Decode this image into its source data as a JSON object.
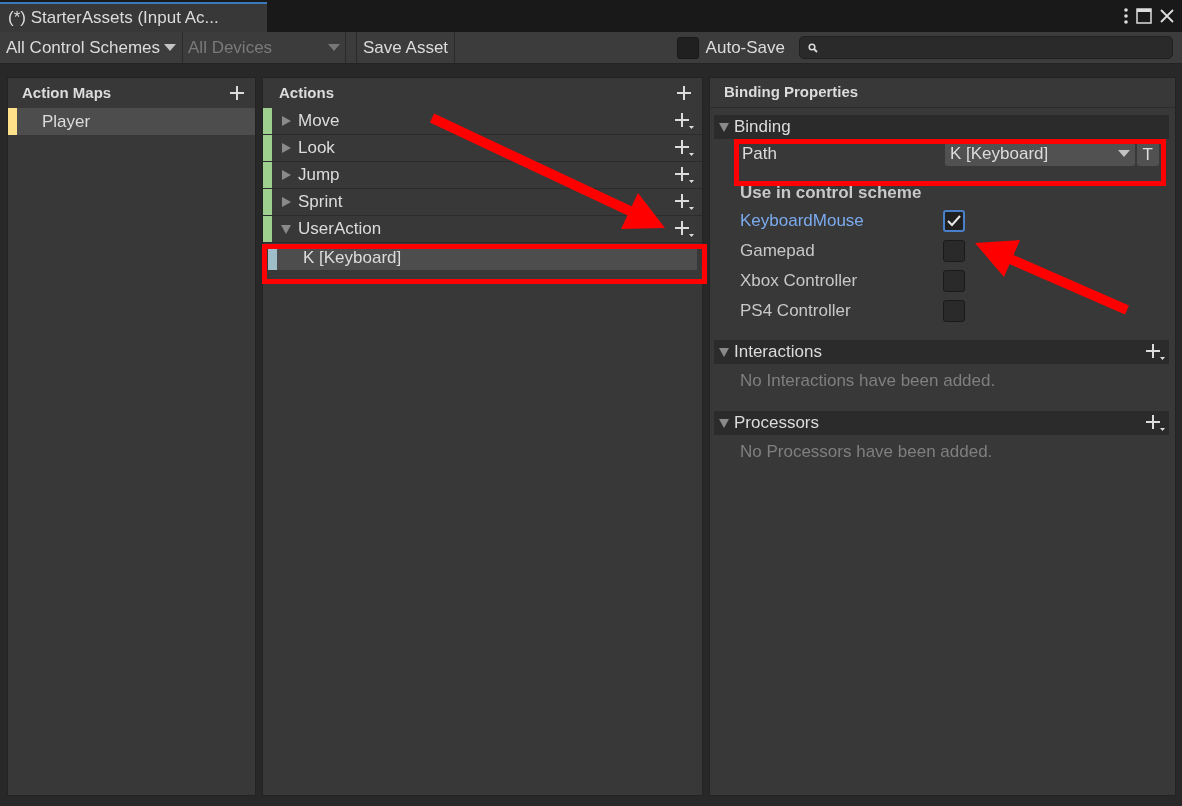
{
  "window": {
    "tab_title": "(*) StarterAssets (Input Ac..."
  },
  "toolbar": {
    "control_schemes": {
      "label": "All Control Schemes",
      "disabled": false
    },
    "devices": {
      "label": "All Devices",
      "disabled": true
    },
    "save_button": "Save Asset",
    "auto_save": {
      "label": "Auto-Save",
      "checked": false
    }
  },
  "action_maps": {
    "title": "Action Maps",
    "items": [
      {
        "name": "Player",
        "selected": true
      }
    ]
  },
  "actions": {
    "title": "Actions",
    "items": [
      {
        "name": "Move",
        "expanded": false
      },
      {
        "name": "Look",
        "expanded": false
      },
      {
        "name": "Jump",
        "expanded": false
      },
      {
        "name": "Sprint",
        "expanded": false
      },
      {
        "name": "UserAction",
        "expanded": true,
        "children": [
          {
            "name": "K [Keyboard]",
            "selected": true
          }
        ]
      }
    ]
  },
  "binding_properties": {
    "title": "Binding Properties",
    "binding": {
      "title": "Binding",
      "path_label": "Path",
      "path_value": "K [Keyboard]",
      "t_button": "T"
    },
    "scheme_heading": "Use in control scheme",
    "schemes": [
      {
        "name": "KeyboardMouse",
        "checked": true
      },
      {
        "name": "Gamepad",
        "checked": false
      },
      {
        "name": "Xbox Controller",
        "checked": false
      },
      {
        "name": "PS4 Controller",
        "checked": false
      }
    ],
    "sections": [
      {
        "title": "Interactions",
        "empty_message": "No Interactions have been added."
      },
      {
        "title": "Processors",
        "empty_message": "No Processors have been added."
      }
    ]
  }
}
